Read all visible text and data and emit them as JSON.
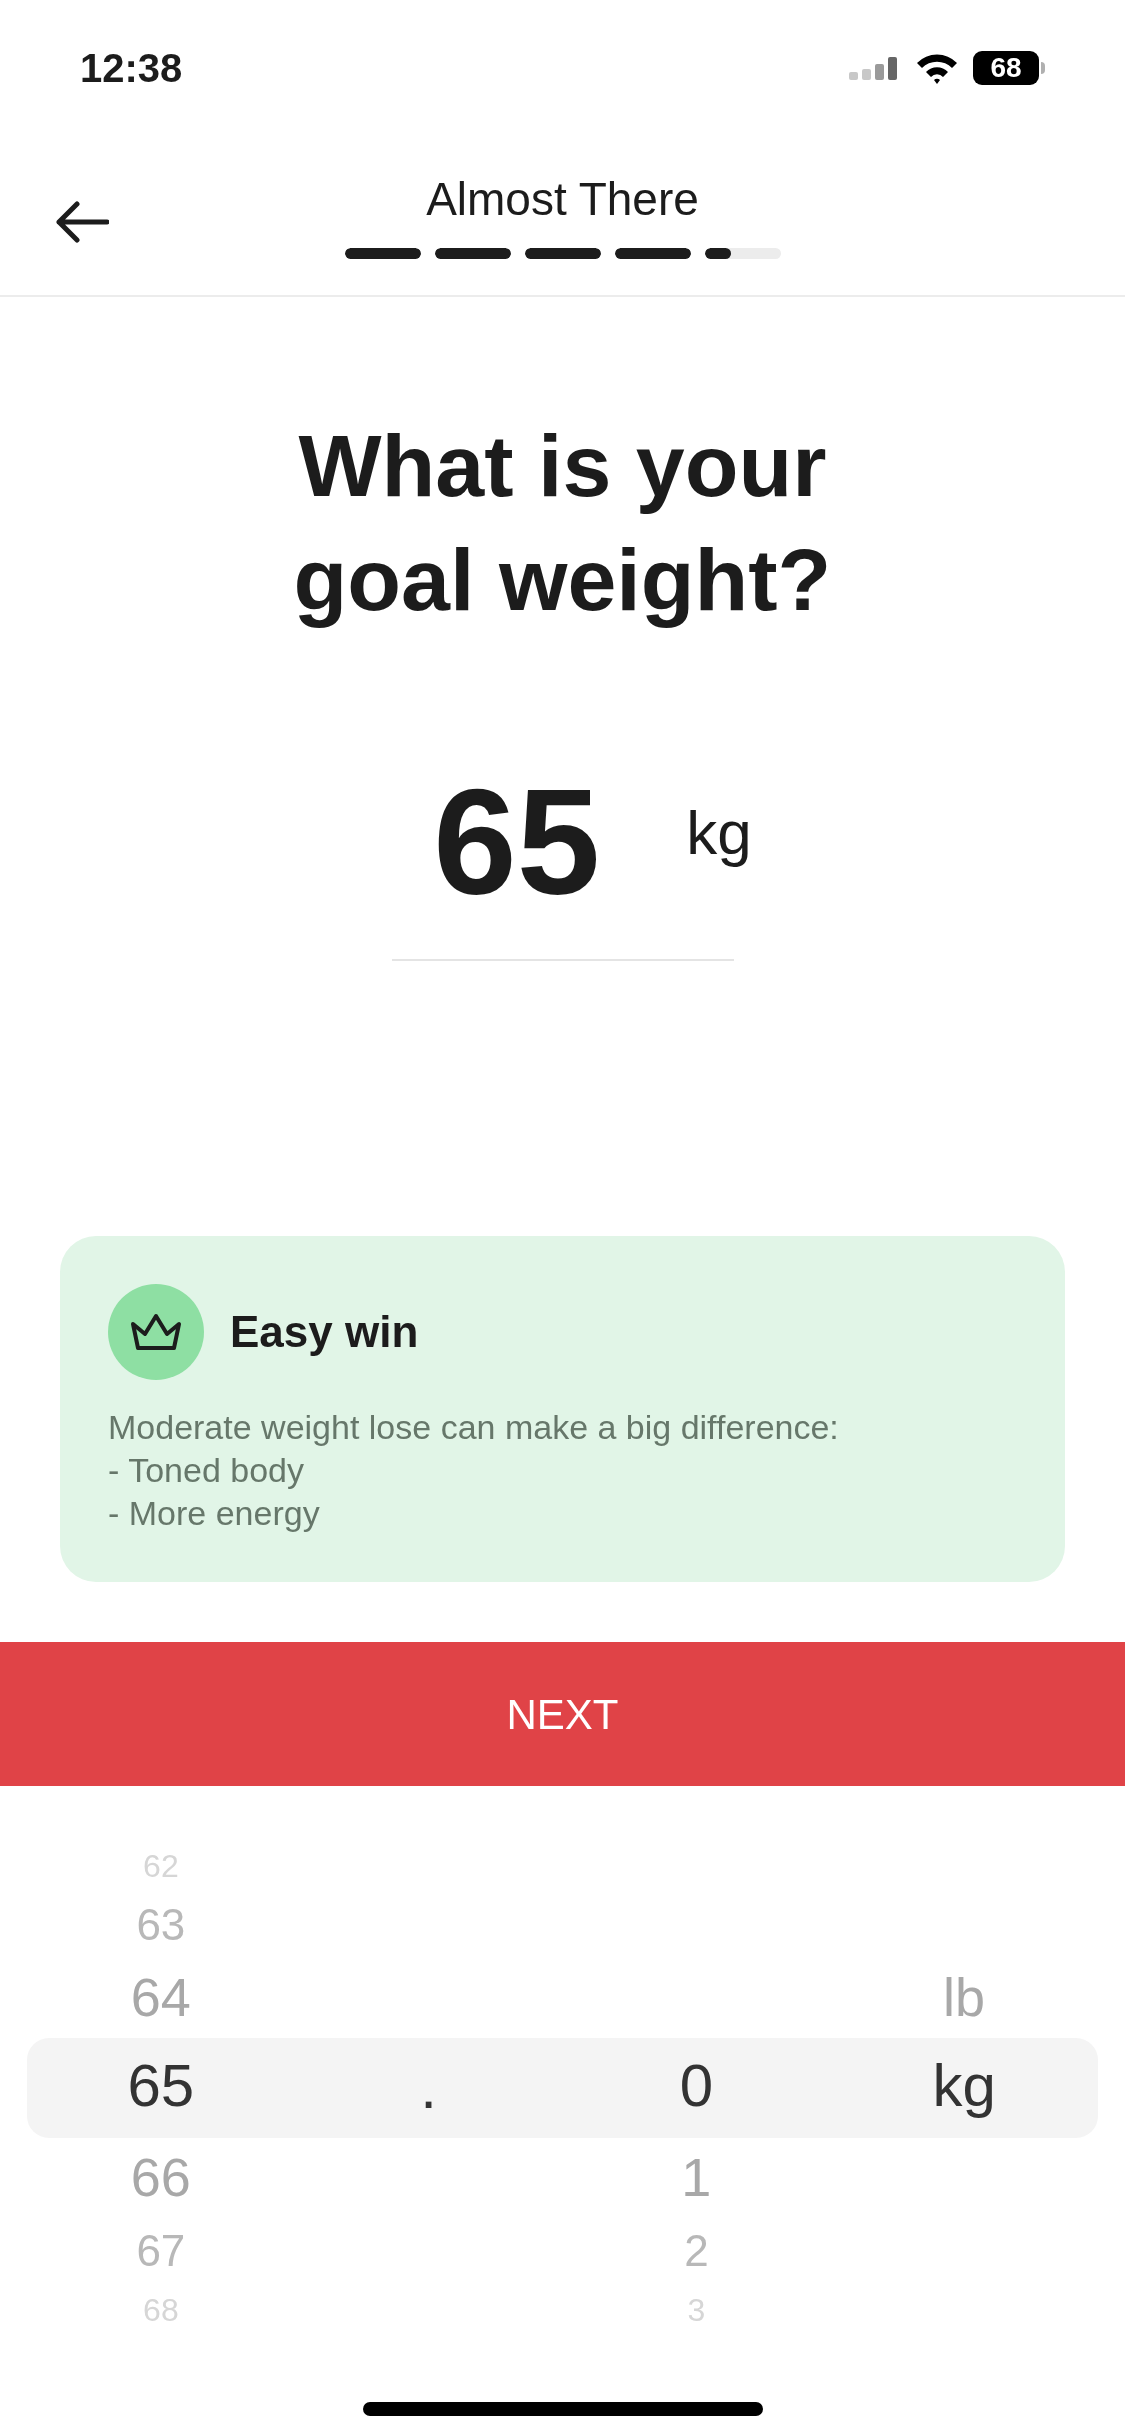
{
  "status_bar": {
    "time": "12:38",
    "battery": "68"
  },
  "header": {
    "title": "Almost There",
    "progress": [
      {
        "level": 1
      },
      {
        "level": 1
      },
      {
        "level": 1
      },
      {
        "level": 1
      },
      {
        "level": 0.35
      }
    ]
  },
  "question": "What is your goal weight?",
  "weight": {
    "value": "65",
    "unit": "kg"
  },
  "tip": {
    "title": "Easy win",
    "text": "Moderate weight lose can make a big difference:\n- Toned body\n- More energy"
  },
  "next_button": "NEXT",
  "picker": {
    "columns": [
      {
        "kind": "wheel",
        "items": [
          {
            "label": "62",
            "selected": false
          },
          {
            "label": "63",
            "selected": false
          },
          {
            "label": "64",
            "selected": false
          },
          {
            "label": "65",
            "selected": true
          },
          {
            "label": "66",
            "selected": false
          },
          {
            "label": "67",
            "selected": false
          },
          {
            "label": "68",
            "selected": false
          }
        ]
      },
      {
        "kind": "separator",
        "label": "."
      },
      {
        "kind": "wheel",
        "items": [
          {
            "label": "0",
            "selected": true
          },
          {
            "label": "1",
            "selected": false
          },
          {
            "label": "2",
            "selected": false
          },
          {
            "label": "3",
            "selected": false
          }
        ]
      },
      {
        "kind": "wheel",
        "items": [
          {
            "label": "lb",
            "selected": false
          },
          {
            "label": "kg",
            "selected": true
          }
        ]
      }
    ]
  }
}
